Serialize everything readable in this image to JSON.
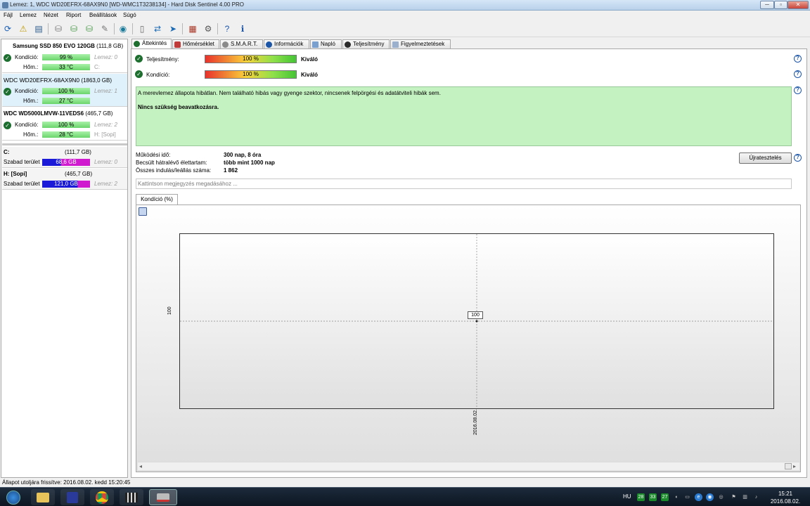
{
  "window": {
    "title": "Lemez: 1, WDC WD20EFRX-68AX9N0 [WD-WMC1T3238134]  -  Hard Disk Sentinel 4.00 PRO",
    "min": "─",
    "max": "▫",
    "close": "✕"
  },
  "menu": [
    "Fájl",
    "Lemez",
    "Nézet",
    "Riport",
    "Beállítások",
    "Súgó"
  ],
  "toolbar_icons": [
    "refresh-icon",
    "disk-warning-icon",
    "disk-info-icon",
    "drive-icon",
    "drive-check-icon",
    "drive-reset-icon",
    "drive-tool-icon",
    "globe-icon",
    "report-icon",
    "sync-icon",
    "send-icon",
    "benchmark-icon",
    "settings-icon",
    "help-icon",
    "info-icon"
  ],
  "disks": [
    {
      "name_bold": "Samsung SSD 850 EVO 120GB",
      "name_size": "(111,8 GB)",
      "kondicio_label": "Kondíció:",
      "kondicio": "99 %",
      "kondicio_pct": 99,
      "hom_label": "Hőm.:",
      "hom": "33 °C",
      "extra1": "Lemez: 0",
      "extra2": "C:"
    },
    {
      "name_bold": "WDC WD20EFRX-68AX9N0",
      "name_size": "(1863,0 GB)",
      "kondicio_label": "Kondíció:",
      "kondicio": "100 %",
      "kondicio_pct": 100,
      "hom_label": "Hőm.:",
      "hom": "27 °C",
      "extra1": "Lemez: 1",
      "extra2": ""
    },
    {
      "name_bold": "WDC WD5000LMVW-11VEDS6",
      "name_size": "(465,7 GB)",
      "kondicio_label": "Kondíció:",
      "kondicio": "100 %",
      "kondicio_pct": 100,
      "hom_label": "Hőm.:",
      "hom": "28 °C",
      "extra1": "Lemez: 2",
      "extra2": "H: [Sopi]"
    }
  ],
  "volumes": [
    {
      "name": "C:",
      "size": "(111,7 GB)",
      "free_label": "Szabad terület",
      "free": "68,6 GB",
      "used_fraction": 0.39,
      "disk": "Lemez: 0"
    },
    {
      "name": "H: [Sopi]",
      "size": "(465,7 GB)",
      "free_label": "Szabad terület",
      "free": "121,0 GB",
      "used_fraction": 0.74,
      "disk": "Lemez: 2"
    }
  ],
  "tabs": [
    "Áttekintés",
    "Hőmérséklet",
    "S.M.A.R.T.",
    "Információk",
    "Napló",
    "Teljesítmény",
    "Figyelmeztetések"
  ],
  "overview": {
    "teljesitmeny_label": "Teljesítmény:",
    "teljesitmeny_value": "100 %",
    "teljesitmeny_rating": "Kiváló",
    "kondicio_label": "Kondíció:",
    "kondicio_value": "100 %",
    "kondicio_rating": "Kiváló",
    "message": "A merevlemez állapota hibátlan. Nem található hibás vagy gyenge szektor, nincsenek felpörgési és adatátviteli hibák sem.",
    "action": "Nincs szükség beavatkozásra.",
    "uptime_label": "Működési idő:",
    "uptime": "300 nap, 8 óra",
    "lifetime_label": "Becsült hátralévő élettartam:",
    "lifetime": "több mint 1000 nap",
    "starts_label": "Összes indulás/leállás száma:",
    "starts": "1 862",
    "reset_button": "Újratesztelés",
    "note_placeholder": "Kattintson megjegyzés megadásához ...",
    "chart_tab": "Kondíció  (%)"
  },
  "chart_data": {
    "type": "line",
    "x": [
      "2016.08.02."
    ],
    "series": [
      {
        "values": [
          100
        ]
      }
    ],
    "ylabel": "",
    "y_tick": "100",
    "x_tick": "2016.08.02.",
    "point_label": "100",
    "grid": true
  },
  "status": "Állapot utoljára frissítve: 2016.08.02. kedd 15:20:45",
  "taskbar": {
    "lang": "HU",
    "temps": [
      "28",
      "33",
      "27"
    ],
    "time": "15:21",
    "date": "2016.08.02.",
    "apps": [
      "start-orb",
      "explorer",
      "save-app",
      "chrome",
      "media-player",
      "hd-sentinel"
    ]
  },
  "colors": {
    "green_bar": "#6ad66a",
    "selected_row": "#dff1fb",
    "status_box": "#c5f2c1",
    "volume_used": "#1a1ad8",
    "volume_free": "#d01ad0"
  }
}
